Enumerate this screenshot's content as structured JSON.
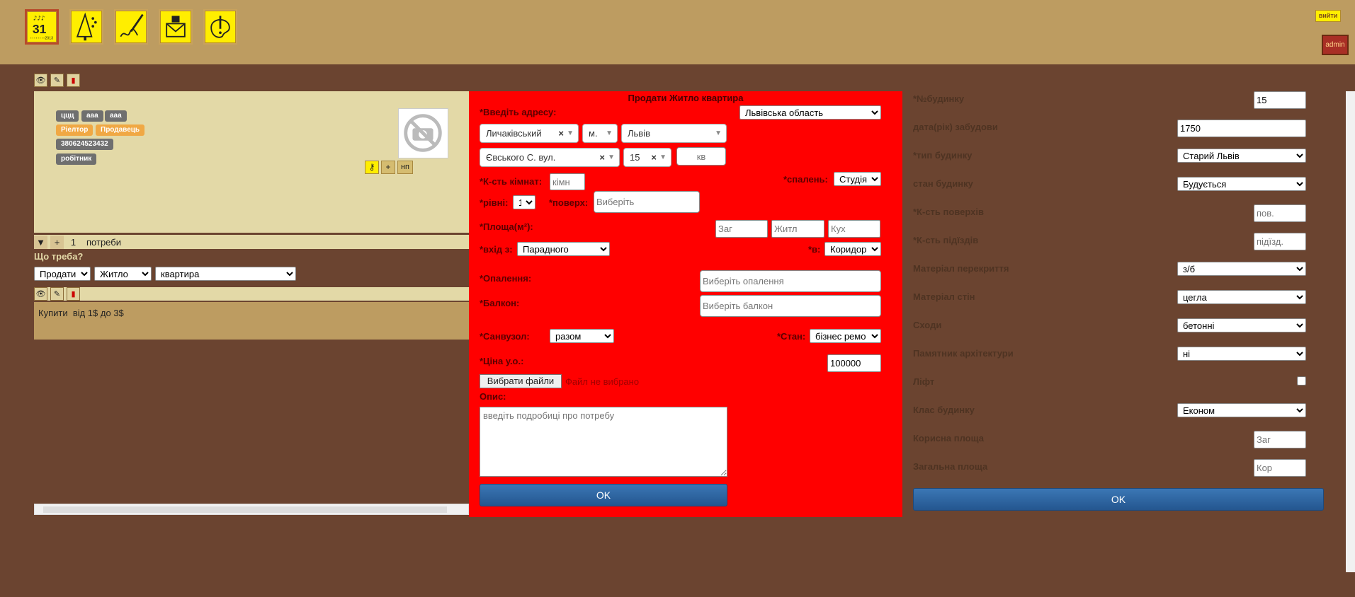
{
  "header": {
    "nav_icons": [
      "calendar-icon",
      "tree-chart-icon",
      "signature-icon",
      "mail-icon",
      "palette-icon"
    ],
    "calendar_day": "31",
    "calendar_year": "2013",
    "logout_label": "вийти",
    "admin_label": "admin"
  },
  "client": {
    "tags": [
      "ццц",
      "ааа",
      "ааа"
    ],
    "roles": [
      "Ріелтор",
      "Продавець"
    ],
    "phone": "380624523432",
    "position": "робітник",
    "tool_plus": "+",
    "tool_np": "нп"
  },
  "needs": {
    "toggle": "▼",
    "add": "+",
    "count": "1",
    "label": "потреби",
    "question": "Що треба?",
    "action_value": "Продати",
    "category_value": "Житло",
    "type_value": "квартира",
    "list_item": "Купити  від 1$ до 3$"
  },
  "form": {
    "title": "Продати Житло квартира",
    "address_label": "*Введіть адресу:",
    "region_value": "Львівська область",
    "district_value": "Личаківський",
    "settlement_type_value": "м.",
    "city_value": "Львів",
    "street_value": "Євського С. вул.",
    "house_value": "15",
    "apartment_placeholder": "кв",
    "rooms_label": "*К-сть кімнат:",
    "rooms_placeholder": "кімн",
    "bedrooms_label": "*спалень:",
    "bedrooms_value": "Студія",
    "levels_label": "*рівні:",
    "levels_value": "1",
    "floor_label": "*поверх:",
    "floor_placeholder": "Виберіть",
    "area_label": "*Площа(м²):",
    "area_total_placeholder": "Заг",
    "area_living_placeholder": "Житл",
    "area_kitchen_placeholder": "Кух",
    "entrance_label": "*вхід з:",
    "entrance_value": "Парадного",
    "into_label": "*в:",
    "into_value": "Коридор",
    "heating_label": "*Опалення:",
    "heating_placeholder": "Виберіть опалення",
    "balcony_label": "*Балкон:",
    "balcony_placeholder": "Виберіть балкон",
    "bathroom_label": "*Санвузол:",
    "bathroom_value": "разом",
    "condition_label": "*Стан:",
    "condition_value": "бізнес ремо",
    "price_label": "*Ціна у.о.:",
    "price_value": "100000",
    "file_button": "Вибрати файли",
    "file_status": "Файл не вибрано",
    "description_label": "Опис:",
    "description_placeholder": "введіть подробиці про потребу",
    "ok_label": "OK"
  },
  "building": {
    "number_label": "*№будинку",
    "number_value": "15",
    "year_label": "дата(рік) забудови",
    "year_value": "1750",
    "type_label": "*тип будинку",
    "type_value": "Старий Львів",
    "state_label": "стан будинку",
    "state_value": "Будується",
    "floors_label": "*К-сть поверхів",
    "floors_placeholder": "пов.",
    "entrances_label": "*К-сть підїздів",
    "entrances_placeholder": "підїзд.",
    "ceiling_label": "Матеріал перекриття",
    "ceiling_value": "з/б",
    "walls_label": "Матеріал стін",
    "walls_value": "цегла",
    "stairs_label": "Сходи",
    "stairs_value": "бетонні",
    "monument_label": "Памятник архітектури",
    "monument_value": "ні",
    "lift_label": "Ліфт",
    "class_label": "Клас будинку",
    "class_value": "Економ",
    "useful_area_label": "Корисна площа",
    "useful_area_placeholder": "Заг",
    "total_area_label": "Загальна площа",
    "total_area_placeholder": "Кор",
    "ok_label": "OK"
  }
}
